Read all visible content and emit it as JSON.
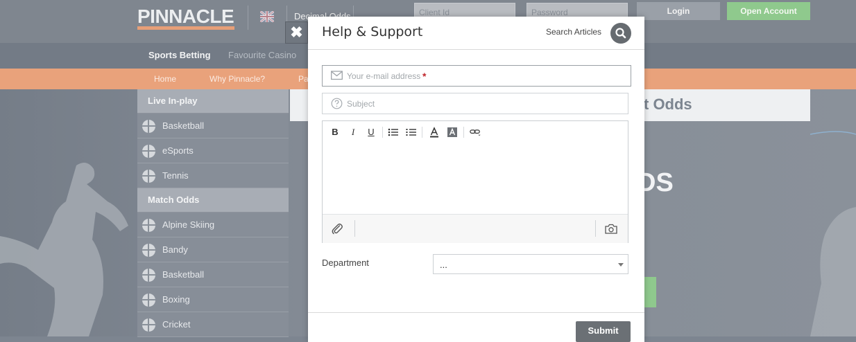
{
  "site": {
    "logo_text": "PINNACLE",
    "odds_format": "Decimal Odds",
    "client_id_placeholder": "Client Id",
    "password_placeholder": "Password",
    "login_label": "Login",
    "open_account_label": "Open Account"
  },
  "main_nav": {
    "items": [
      {
        "label": "Sports Betting",
        "active": true
      },
      {
        "label": "Favourite Casino",
        "active": false
      }
    ]
  },
  "sub_nav": {
    "items": [
      "Home",
      "Why Pinnacle?",
      "Pa"
    ]
  },
  "sidebar": {
    "sections": [
      {
        "header": "Live In-play",
        "items": [
          "Basketball",
          "eSports",
          "Tennis"
        ]
      },
      {
        "header": "Match Odds",
        "items": [
          "Alpine Skiing",
          "Bandy",
          "Basketball",
          "Boxing",
          "Cricket"
        ]
      }
    ]
  },
  "content": {
    "title_fragment": "t Odds",
    "hero_fragment": "DS"
  },
  "modal": {
    "title": "Help & Support",
    "search_label": "Search Articles",
    "email_placeholder": "Your e-mail address",
    "required_mark": "*",
    "subject_placeholder": "Subject",
    "toolbar": {
      "bold": "B",
      "italic": "I",
      "underline": "U"
    },
    "department_label": "Department",
    "department_value": "...",
    "submit_label": "Submit",
    "close_symbol": "✖"
  },
  "colors": {
    "accent_orange": "#e9a27b",
    "accent_green": "#8fc98d",
    "button_dark": "#6b7075"
  }
}
